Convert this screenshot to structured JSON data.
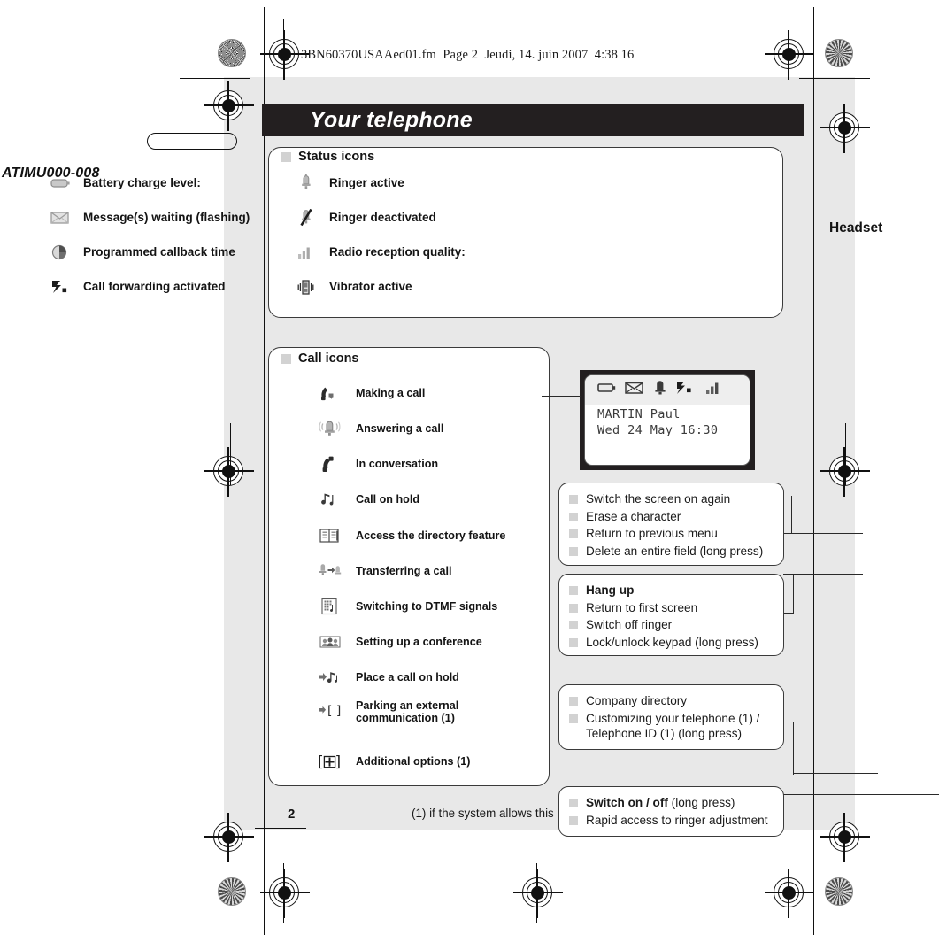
{
  "print_marks": {
    "file_header": "3BN60370USAAed01.fm  Page 2  Jeudi, 14. juin 2007  4:38 16",
    "doc_code": "ATIMU000-008"
  },
  "header": {
    "title": "Your telephone"
  },
  "side_labels": {
    "headset": "Headset"
  },
  "status_icons": {
    "heading": "Status icons",
    "items": [
      {
        "icon": "battery-icon",
        "label": "Battery charge level:"
      },
      {
        "icon": "envelope-icon",
        "label": "Message(s) waiting (flashing)"
      },
      {
        "icon": "clock-icon",
        "label": "Programmed callback time"
      },
      {
        "icon": "call-forward-icon",
        "label": "Call forwarding activated"
      },
      {
        "icon": "bell-icon",
        "label": "Ringer active"
      },
      {
        "icon": "bell-crossed-icon",
        "label": "Ringer deactivated"
      },
      {
        "icon": "signal-bars-icon",
        "label": "Radio reception quality:"
      },
      {
        "icon": "vibrator-icon",
        "label": "Vibrator active"
      }
    ]
  },
  "call_icons": {
    "heading": "Call icons",
    "items": [
      {
        "icon": "handset-outgoing-icon",
        "label": "Making a call"
      },
      {
        "icon": "ringing-bell-icon",
        "label": "Answering a call"
      },
      {
        "icon": "handset-active-icon",
        "label": "In conversation"
      },
      {
        "icon": "music-notes-icon",
        "label": "Call on hold"
      },
      {
        "icon": "directory-book-icon",
        "label": "Access the directory feature"
      },
      {
        "icon": "transfer-icon",
        "label": "Transferring a call"
      },
      {
        "icon": "dtmf-keypad-icon",
        "label": "Switching to DTMF signals"
      },
      {
        "icon": "conference-icon",
        "label": "Setting up a conference"
      },
      {
        "icon": "hold-note-icon",
        "label": "Place a call on hold"
      },
      {
        "icon": "park-brackets-icon",
        "label": "Parking an external communication  (1)"
      },
      {
        "icon": "plus-brackets-icon",
        "label": "Additional options (1)"
      }
    ]
  },
  "lcd": {
    "status_icons": [
      "battery-icon",
      "envelope-icon",
      "bell-icon",
      "call-forward-icon",
      "signal-bars-icon"
    ],
    "line1": "MARTIN Paul",
    "line2": "Wed 24 May 16:30"
  },
  "callouts": {
    "nav": {
      "name": "navigation-key-callout",
      "rows": [
        {
          "bold": "",
          "text": "Switch the screen on again"
        },
        {
          "bold": "",
          "text": "Erase a character"
        },
        {
          "bold": "",
          "text": "Return to previous menu"
        },
        {
          "bold": "",
          "text": "Delete an entire field (long press)"
        }
      ]
    },
    "hangup": {
      "name": "hang-up-key-callout",
      "rows": [
        {
          "bold": "Hang up",
          "text": ""
        },
        {
          "bold": "",
          "text": "Return to first screen"
        },
        {
          "bold": "",
          "text": "Switch off ringer"
        },
        {
          "bold": "",
          "text": "Lock/unlock keypad (long press)"
        }
      ]
    },
    "directory": {
      "name": "directory-key-callout",
      "rows": [
        {
          "bold": "",
          "text": "Company directory"
        },
        {
          "bold": "",
          "text": "Customizing your telephone (1) / Telephone ID (1) (long press)"
        }
      ]
    },
    "power": {
      "name": "power-key-callout",
      "rows": [
        {
          "bold": "Switch on / off",
          "text": " (long press)"
        },
        {
          "bold": "",
          "text": "Rapid access to ringer adjustment"
        }
      ]
    }
  },
  "footer": {
    "footnote": "(1) if the system allows this",
    "page_number": "2"
  },
  "colors": {
    "page_background": "#e8e8e8",
    "title_bar": "#231f20",
    "panel_border": "#3a3a3a",
    "marker_square": "#d2d2d2"
  }
}
